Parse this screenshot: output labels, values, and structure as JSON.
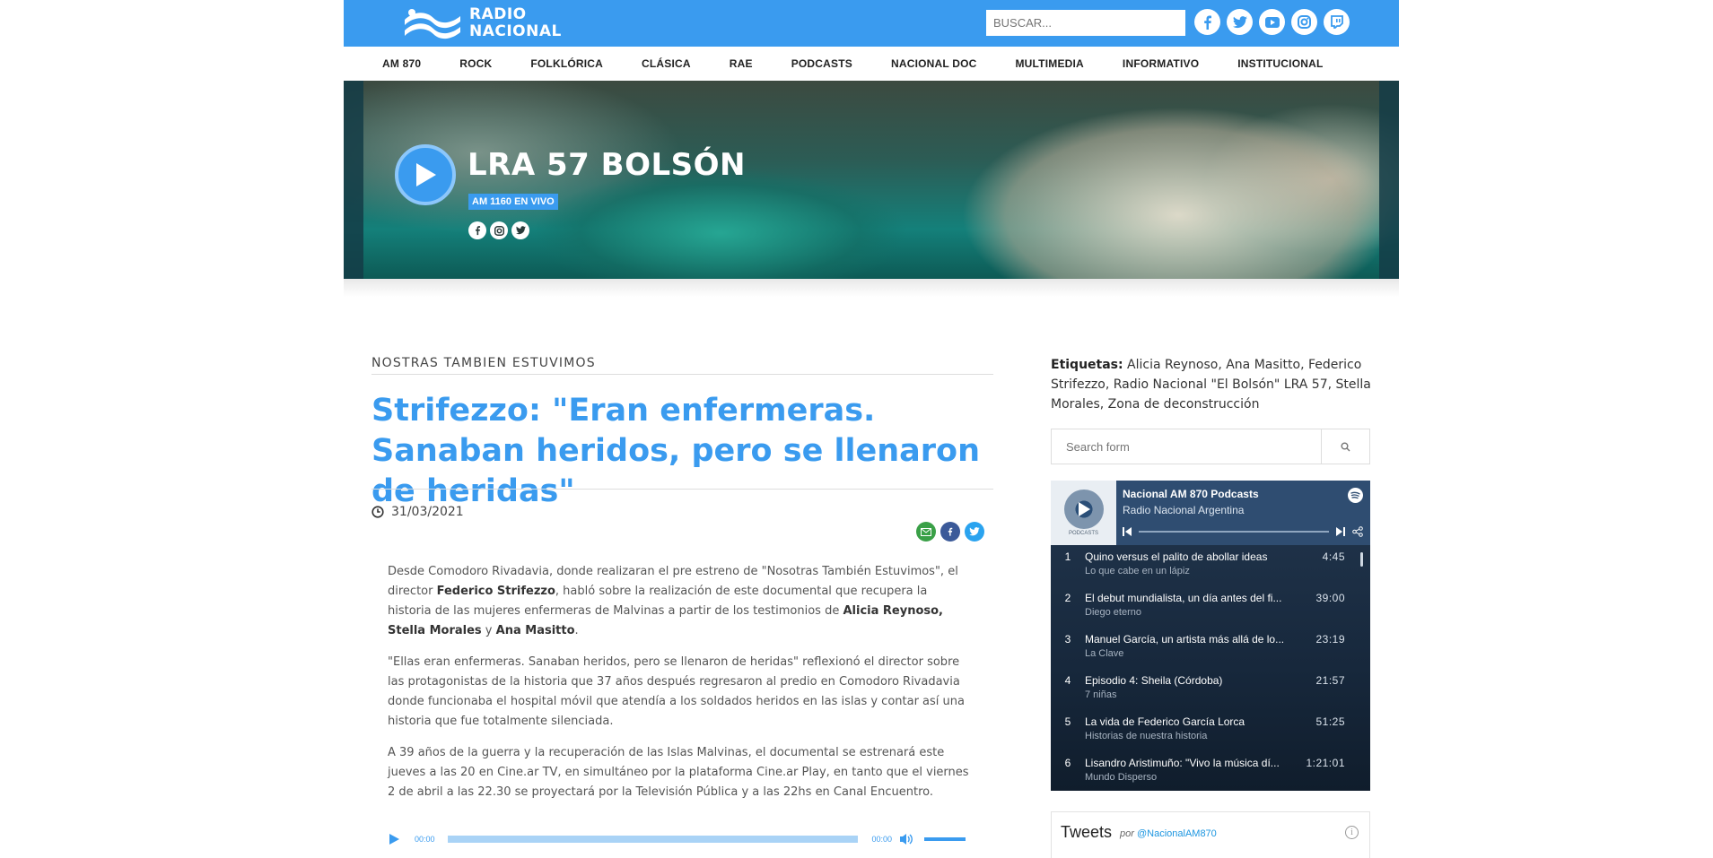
{
  "header": {
    "logo_line1": "RADIO",
    "logo_line2": "NACIONAL",
    "search_placeholder": "BUSCAR...",
    "social_icons": [
      "facebook-icon",
      "twitter-icon",
      "youtube-icon",
      "instagram-icon",
      "twitch-icon"
    ],
    "brand_color": "#3a9bef"
  },
  "nav": {
    "items": [
      "AM 870",
      "ROCK",
      "FOLKLÓRICA",
      "CLÁSICA",
      "RAE",
      "PODCASTS",
      "NACIONAL DOC",
      "MULTIMEDIA",
      "INFORMATIVO",
      "INSTITUCIONAL"
    ]
  },
  "hero": {
    "station": "LRA 57 BOLSÓN",
    "badge": "AM 1160 EN VIVO",
    "social_icons": [
      "facebook-icon",
      "instagram-icon",
      "twitter-icon"
    ]
  },
  "article": {
    "kicker": "NOSTRAS TAMBIEN ESTUVIMOS",
    "headline": "Strifezzo: \"Eran enfermeras. Sanaban heridos, pero se llenaron de heridas\"",
    "date": "31/03/2021",
    "p1": {
      "a": "Desde Comodoro Rivadavia, donde realizaran el pre estreno de \"Nosotras También Estuvimos\", el director ",
      "b1": "Federico Strifezzo",
      "c": ", habló sobre la realización de este documental que recupera la historia de las mujeres enfermeras de Malvinas a partir de los testimonios de ",
      "b2": "Alicia Reynoso, Stella Morales",
      "d": " y ",
      "b3": "Ana Masitto",
      "e": "."
    },
    "p2": "\"Ellas eran enfermeras. Sanaban heridos, pero se llenaron de heridas\" reflexionó el director sobre las protagonistas de la historia que 37 años después regresaron al predio en Comodoro Rivadavia donde funcionaba el hospital móvil que atendía a los soldados heridos en las islas y contar así una historia que fue totalmente silenciada.",
    "p3": "A 39 años de la guerra y la recuperación de las Islas Malvinas, el documental se estrenará este jueves a las 20 en Cine.ar TV, en simultáneo por la plataforma Cine.ar Play, en tanto que el viernes 2 de abril a las 22.30 se proyectará por la Televisión Pública y a las 22hs en Canal Encuentro.",
    "audio": {
      "current": "00:00",
      "duration": "00:00"
    }
  },
  "sidebar": {
    "tags_label": "Etiquetas:",
    "tags_text": " Alicia Reynoso, Ana Masitto, Federico Strifezzo, Radio Nacional \"El Bolsón\" LRA 57, Stella Morales, Zona de deconstrucción",
    "search_placeholder": "Search form",
    "podcast": {
      "title": "Nacional AM 870 Podcasts",
      "subtitle": "Radio Nacional Argentina",
      "cover_label": "PODCASTS",
      "episodes": [
        {
          "num": "1",
          "name": "Quino versus el palito de abollar ideas",
          "show": "Lo que cabe en un lápiz",
          "duration": "4:45"
        },
        {
          "num": "2",
          "name": "El debut mundialista, un día antes del fi...",
          "show": "Diego eterno",
          "duration": "39:00"
        },
        {
          "num": "3",
          "name": "Manuel García, un artista más allá de lo...",
          "show": "La Clave",
          "duration": "23:19"
        },
        {
          "num": "4",
          "name": "Episodio 4: Sheila (Córdoba)",
          "show": "7 niñas",
          "duration": "21:57"
        },
        {
          "num": "5",
          "name": "La vida de Federico García Lorca",
          "show": "Historias de nuestra historia",
          "duration": "51:25"
        },
        {
          "num": "6",
          "name": "Lisandro Aristimuño: \"Vivo la música dí...",
          "show": "Mundo Disperso",
          "duration": "1:21:01"
        }
      ]
    },
    "tweets": {
      "title": "Tweets",
      "by": "por",
      "handle": "@NacionalAM870",
      "info": "i"
    }
  }
}
